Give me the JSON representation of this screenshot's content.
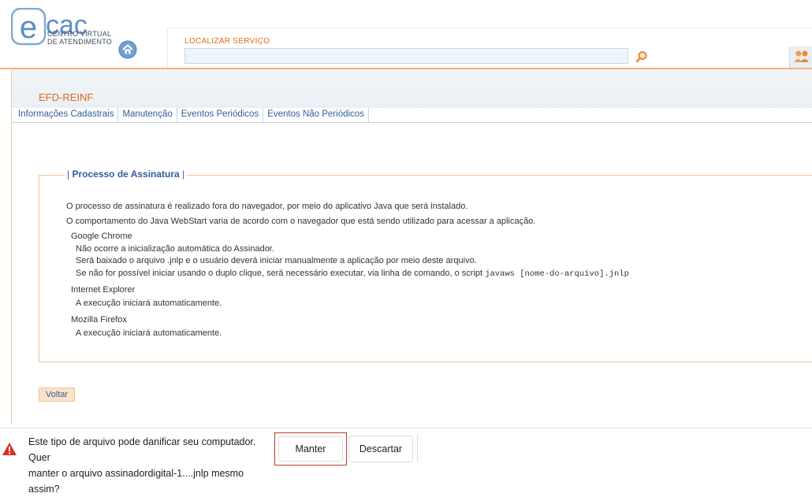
{
  "header": {
    "logo_text": "ecac",
    "logo_subtitle_line1": "CENTRO VIRTUAL",
    "logo_subtitle_line2": "DE ATENDIMENTO",
    "search_label": "LOCALIZAR SERVIÇO",
    "search_value": "",
    "icons": {
      "home": "home-icon",
      "search": "magnifier-icon",
      "people": "people-icon"
    }
  },
  "app": {
    "title": "EFD-REINF",
    "tabs": [
      {
        "label": "Informações Cadastrais"
      },
      {
        "label": "Manutenção"
      },
      {
        "label": "Eventos Periódicos"
      },
      {
        "label": "Eventos Não Periódicos"
      }
    ]
  },
  "section": {
    "legend_prefix": "| ",
    "legend_title": "Processo de Assinatura",
    "legend_suffix": " |",
    "intro1": "O processo de assinatura é realizado fora do navegador, por meio do aplicativo Java que será instalado.",
    "intro2": "O comportamento do Java WebStart varia de acordo com o navegador que está sendo utilizado para acessar a aplicação.",
    "chrome": {
      "name": "Google Chrome",
      "line1": "Não ocorre a inicialização automática do Assinador.",
      "line2": "Será baixado o arquivo .jnlp e o usuário deverá iniciar manualmente a aplicação por meio deste arquivo.",
      "line3": "Se não for possível iniciar usando o duplo clique, será necessário executar, via linha de comando, o script ",
      "line3_code": "javaws [nome-do-arquivo].jnlp"
    },
    "ie": {
      "name": "Internet Explorer",
      "line1": "A execução iniciará automaticamente."
    },
    "firefox": {
      "name": "Mozilla Firefox",
      "line1": "A execução iniciará automaticamente."
    },
    "back_button": "Voltar"
  },
  "download_bar": {
    "message_line1": "Este tipo de arquivo pode danificar seu computador. Quer",
    "message_line2": "manter o arquivo assinadordigital-1....jnlp mesmo assim?",
    "keep_button": "Manter",
    "discard_button": "Descartar",
    "warning_icon": "warning-triangle-icon",
    "colors": {
      "warning": "#d93025",
      "highlight_border": "#c0392b"
    }
  },
  "colors": {
    "accent_orange": "#e06a1b",
    "link_blue": "#2f5d9c",
    "logo_blue": "#5b8fc7"
  }
}
